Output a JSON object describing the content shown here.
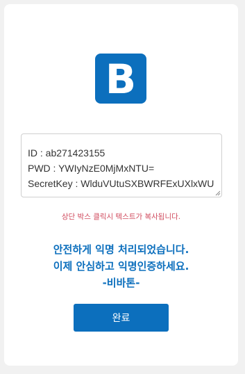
{
  "logo": {
    "letter": "B",
    "color": "#0c6fbd"
  },
  "credentials": {
    "id_line": "ID : ab271423155",
    "pwd_line": "PWD : YWIyNzE0MjMxNTU=",
    "secret_line": "SecretKey : WlduVUtuSXBWRFExUXlxWU"
  },
  "hint": "상단 박스 클릭시 텍스트가 복사됩니다.",
  "message": {
    "line1": "안전하게 익명 처리되었습니다.",
    "line2": "이제 안심하고 익명인증하세요.",
    "line3": "-비바톤-"
  },
  "complete_button": {
    "label": "완료"
  },
  "colors": {
    "accent": "#0c6fbd",
    "hint": "#d04b5e",
    "background": "#f1f1f1"
  }
}
